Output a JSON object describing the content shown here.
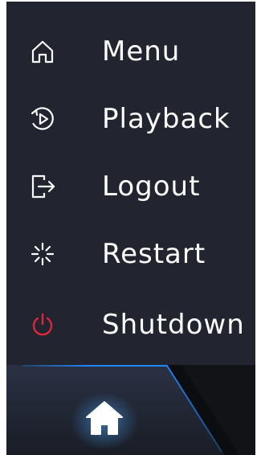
{
  "menu": {
    "items": [
      {
        "label": "Menu",
        "icon": "home-outline-icon"
      },
      {
        "label": "Playback",
        "icon": "playback-icon"
      },
      {
        "label": "Logout",
        "icon": "logout-icon"
      },
      {
        "label": "Restart",
        "icon": "restart-icon"
      },
      {
        "label": "Shutdown",
        "icon": "power-icon",
        "icon_color": "#e0263a"
      }
    ]
  },
  "dock": {
    "home_icon": "home-icon",
    "accent": "#1e88ff"
  },
  "colors": {
    "panel": "#22252f",
    "text": "#ffffff",
    "dock": "#121316"
  }
}
